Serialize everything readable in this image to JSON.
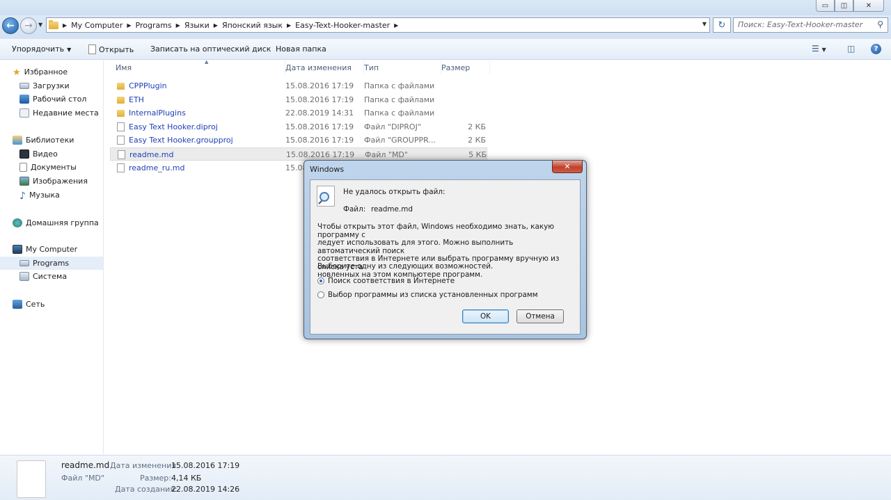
{
  "window": {
    "minimize_glyph": "▭",
    "maximize_glyph": "◫",
    "close_glyph": "✕"
  },
  "address": {
    "crumbs": [
      "My Computer",
      "Programs",
      "Языки",
      "Японский язык",
      "Easy-Text-Hooker-master"
    ],
    "search_placeholder": "Поиск: Easy-Text-Hooker-master"
  },
  "toolbar": {
    "organize": "Упорядочить",
    "open": "Открыть",
    "burn": "Записать на оптический диск",
    "new_folder": "Новая папка"
  },
  "nav": {
    "favorites": "Избранное",
    "downloads": "Загрузки",
    "desktop": "Рабочий стол",
    "recent": "Недавние места",
    "libraries": "Библиотеки",
    "video": "Видео",
    "documents": "Документы",
    "images": "Изображения",
    "music": "Музыка",
    "homegroup": "Домашняя группа",
    "computer": "My Computer",
    "programs": "Programs",
    "system": "Система",
    "network": "Сеть"
  },
  "columns": {
    "name": "Имя",
    "date": "Дата изменения",
    "type": "Тип",
    "size": "Размер"
  },
  "files": [
    {
      "name": "CPPPlugin",
      "date": "15.08.2016 17:19",
      "type": "Папка с файлами",
      "size": "",
      "kind": "folder"
    },
    {
      "name": "ETH",
      "date": "15.08.2016 17:19",
      "type": "Папка с файлами",
      "size": "",
      "kind": "folder"
    },
    {
      "name": "InternalPlugins",
      "date": "22.08.2019 14:31",
      "type": "Папка с файлами",
      "size": "",
      "kind": "folder"
    },
    {
      "name": "Easy Text Hooker.diproj",
      "date": "15.08.2016 17:19",
      "type": "Файл \"DIPROJ\"",
      "size": "2 КБ",
      "kind": "doc"
    },
    {
      "name": "Easy Text Hooker.groupproj",
      "date": "15.08.2016 17:19",
      "type": "Файл \"GROUPPR...",
      "size": "2 КБ",
      "kind": "doc"
    },
    {
      "name": "readme.md",
      "date": "15.08.2016 17:19",
      "type": "Файл \"MD\"",
      "size": "5 КБ",
      "kind": "doc"
    },
    {
      "name": "readme_ru.md",
      "date": "15.08",
      "type": "",
      "size": "",
      "kind": "doc"
    }
  ],
  "details": {
    "filename": "readme.md",
    "filetype": "Файл \"MD\"",
    "modified_label": "Дата изменения:",
    "modified_value": "15.08.2016 17:19",
    "size_label": "Размер:",
    "size_value": "4,14 КБ",
    "created_label": "Дата создания:",
    "created_value": "22.08.2019 14:26"
  },
  "dialog": {
    "title": "Windows",
    "heading": "Не удалось открыть файл:",
    "file_label": "Файл:",
    "file_value": "readme.md",
    "message_lines": [
      "Чтобы открыть этот файл, Windows необходимо знать, какую программу с",
      "ледует использовать для этого. Можно выполнить автоматический поиск",
      "соответствия в Интернете или выбрать программу вручную из списка уста",
      "новленных на этом компьютере программ."
    ],
    "prompt": "Выберите одну из следующих возможностей.",
    "option_web": "Поиск соответствия в Интернете",
    "option_list": "Выбор программы из списка установленных программ",
    "ok": "OK",
    "cancel": "Отмена"
  }
}
